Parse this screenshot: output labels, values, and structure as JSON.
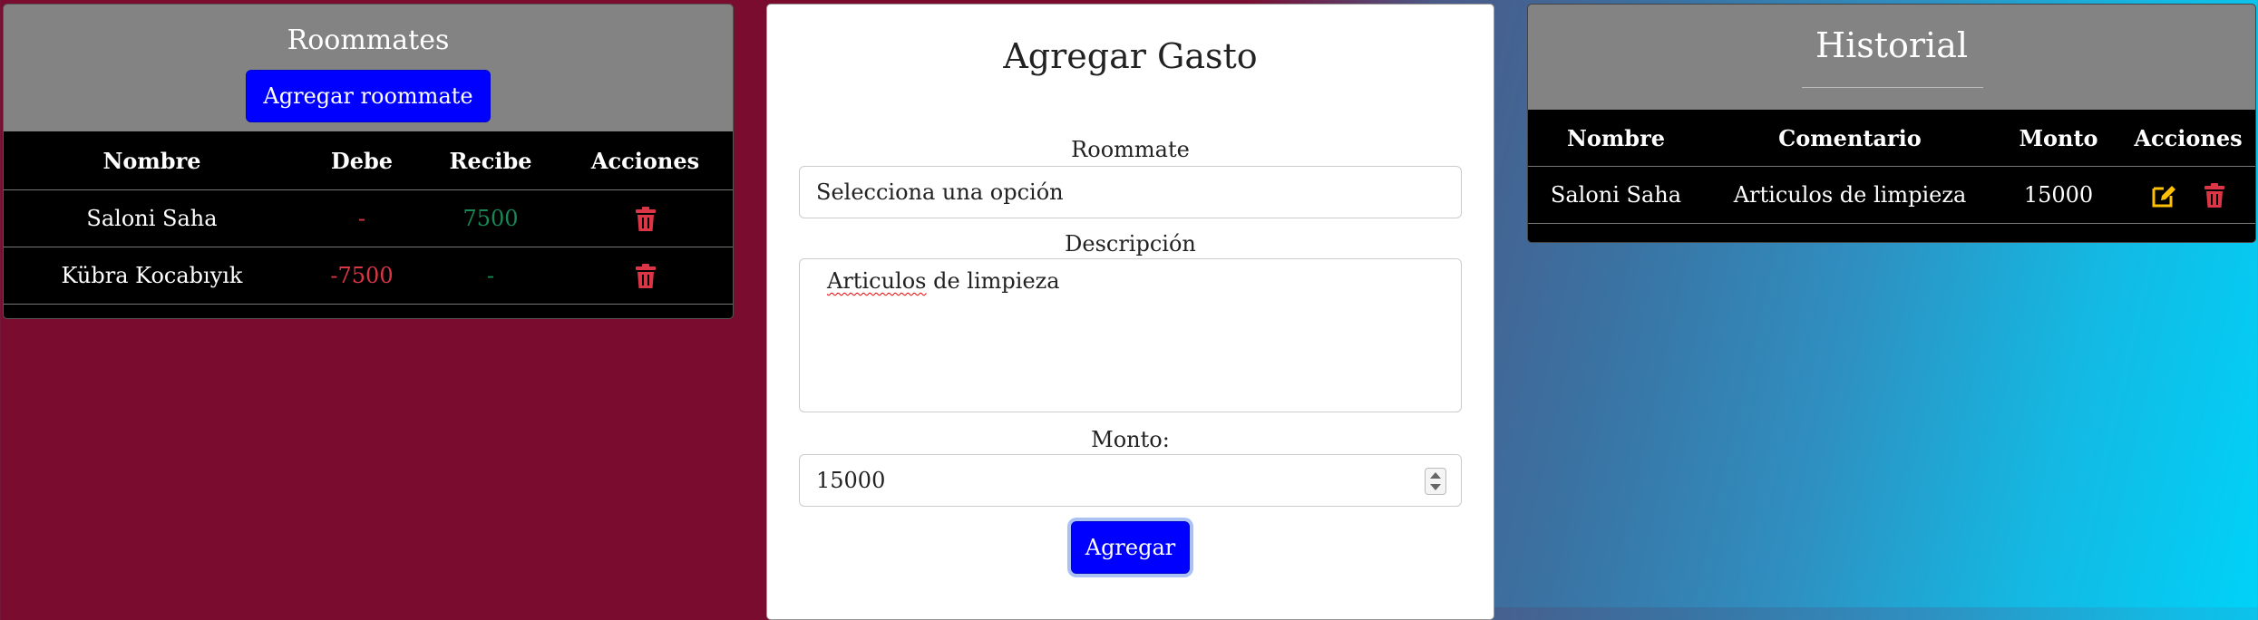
{
  "roommates": {
    "title": "Roommates",
    "add_button": "Agregar roommate",
    "columns": [
      "Nombre",
      "Debe",
      "Recibe",
      "Acciones"
    ],
    "rows": [
      {
        "name": "Saloni Saha",
        "debe": "-",
        "recibe": "7500"
      },
      {
        "name": "Kübra Kocabıyık",
        "debe": "-7500",
        "recibe": "-"
      }
    ]
  },
  "form": {
    "title": "Agregar Gasto",
    "roommate_label": "Roommate",
    "roommate_value": "Selecciona una opción",
    "description_label": "Descripción",
    "description_word1": "Articulos",
    "description_rest": " de limpieza",
    "amount_label": "Monto:",
    "amount_value": "15000",
    "submit": "Agregar"
  },
  "historial": {
    "title": "Historial",
    "columns": [
      "Nombre",
      "Comentario",
      "Monto",
      "Acciones"
    ],
    "rows": [
      {
        "name": "Saloni Saha",
        "comment": "Articulos de limpieza",
        "amount": "15000"
      }
    ]
  },
  "icons": {
    "delete": "trash-icon",
    "edit": "edit-icon"
  },
  "colors": {
    "button": "#0000ff",
    "debt": "#dc3545",
    "credit": "#198754",
    "edit": "#ffc107",
    "delete": "#dc3545"
  }
}
